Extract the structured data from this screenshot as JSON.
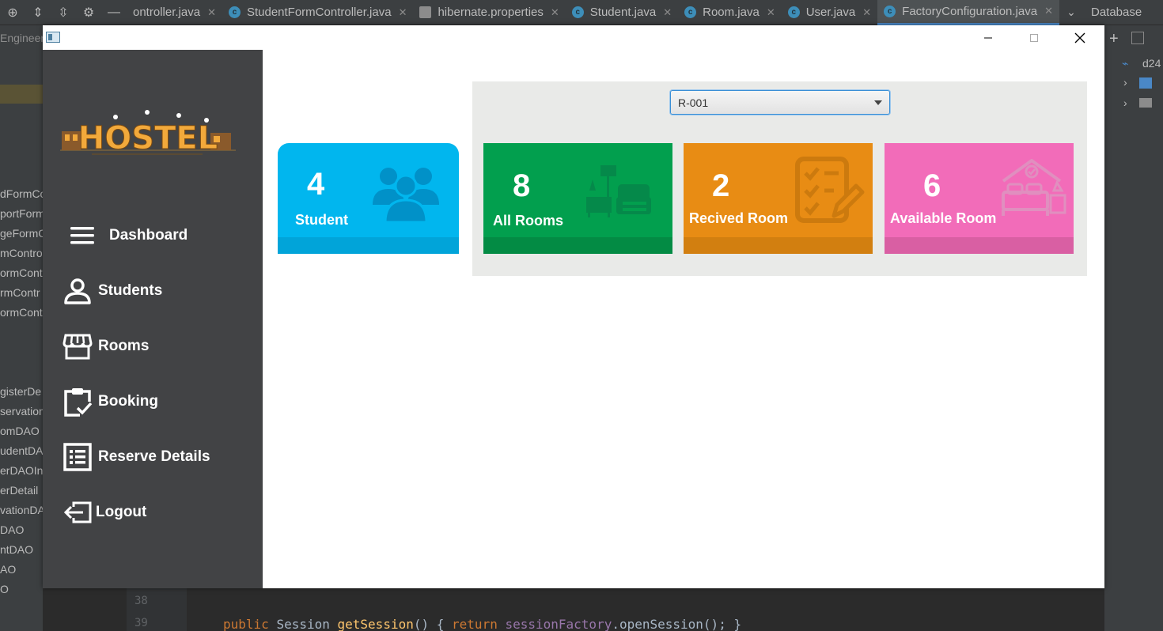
{
  "ide": {
    "tabs": [
      {
        "label": "ontroller.java",
        "icon": "class-icon"
      },
      {
        "label": "StudentFormController.java",
        "icon": "class-icon"
      },
      {
        "label": "hibernate.properties",
        "icon": "properties-icon"
      },
      {
        "label": "Student.java",
        "icon": "class-icon"
      },
      {
        "label": "Room.java",
        "icon": "class-icon"
      },
      {
        "label": "User.java",
        "icon": "class-icon"
      },
      {
        "label": "FactoryConfiguration.java",
        "icon": "class-icon"
      }
    ],
    "active_tab": "FactoryConfiguration.java",
    "database_title": "Database",
    "db_node": "d24",
    "left_tree": [
      "Engineer",
      "dFormCo",
      "portForm",
      "geFormC",
      "mControl",
      "ormCont",
      "rmContr",
      "ormContr",
      "gisterDe",
      "servation",
      "omDAO",
      "udentDA",
      "erDAOIn",
      "erDetail",
      "vationDA",
      "DAO",
      "ntDAO",
      "AO",
      "O"
    ],
    "line_numbers": [
      "38",
      "39"
    ],
    "code": {
      "kw1": "public",
      "type": "Session",
      "fn": "getSession",
      "paren": "()",
      "brace_open": "{",
      "kw2": "return",
      "field": "sessionFactory",
      "call": ".openSession();",
      "brace_close": "}"
    }
  },
  "sidebar": {
    "logo_text": "HOSTEL",
    "items": [
      {
        "label": "Dashboard",
        "icon": "menu-icon"
      },
      {
        "label": "Students",
        "icon": "user-icon"
      },
      {
        "label": "Rooms",
        "icon": "store-icon"
      },
      {
        "label": "Booking",
        "icon": "clipboard-check-icon"
      },
      {
        "label": "Reserve Details",
        "icon": "list-icon"
      },
      {
        "label": "Logout",
        "icon": "logout-icon"
      }
    ]
  },
  "student_card": {
    "count": "4",
    "label": "Student",
    "color": "#01b6ee",
    "strip": "#01a4d9"
  },
  "room_selector": {
    "selected": "R-001"
  },
  "room_cards": [
    {
      "count": "8",
      "label": "All Rooms",
      "color": "#029f4e",
      "strip": "#038b44",
      "icon": "furniture-icon"
    },
    {
      "count": "2",
      "label": "Recived Room",
      "color": "#e88c14",
      "strip": "#d27f10",
      "icon": "checklist-icon"
    },
    {
      "count": "6",
      "label": "Available Room",
      "color": "#f26cb9",
      "strip": "#d95fa3",
      "icon": "bedroom-icon"
    }
  ]
}
